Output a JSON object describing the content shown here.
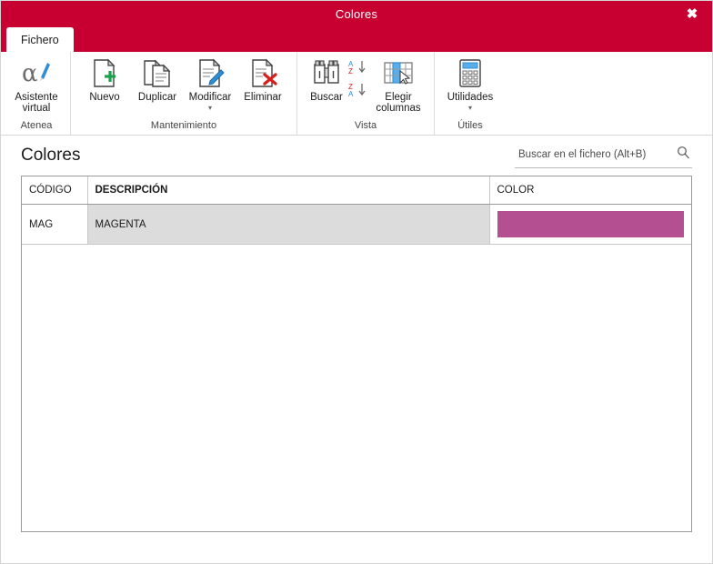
{
  "window": {
    "title": "Colores",
    "close_label": "✖",
    "accent_color": "#c80032"
  },
  "tabs": [
    {
      "label": "Fichero",
      "active": true
    }
  ],
  "ribbon": {
    "groups": [
      {
        "label": "Atenea",
        "items": [
          {
            "label": "Asistente\nvirtual",
            "icon": "alpha-pen-icon",
            "caret": false
          }
        ]
      },
      {
        "label": "Mantenimiento",
        "items": [
          {
            "label": "Nuevo",
            "icon": "document-plus-icon",
            "caret": false
          },
          {
            "label": "Duplicar",
            "icon": "document-copy-icon",
            "caret": false
          },
          {
            "label": "Modificar",
            "icon": "document-pencil-icon",
            "caret": true
          },
          {
            "label": "Eliminar",
            "icon": "document-delete-icon",
            "caret": false
          }
        ]
      },
      {
        "label": "Vista",
        "items": [
          {
            "label": "Buscar",
            "icon": "binoculars-icon",
            "caret": false
          },
          {
            "label": "sort-asc",
            "icon": "sort-az-icon",
            "caret": false
          },
          {
            "label": "sort-desc",
            "icon": "sort-za-icon",
            "caret": false
          },
          {
            "label": "Elegir\ncolumnas",
            "icon": "choose-columns-icon",
            "caret": false
          }
        ]
      },
      {
        "label": "Útiles",
        "items": [
          {
            "label": "Utilidades",
            "icon": "calculator-icon",
            "caret": true
          }
        ]
      }
    ],
    "labels": {
      "asistente_line1": "Asistente",
      "asistente_line2": "virtual",
      "nuevo": "Nuevo",
      "duplicar": "Duplicar",
      "modificar": "Modificar",
      "eliminar": "Eliminar",
      "buscar": "Buscar",
      "elegir_line1": "Elegir",
      "elegir_line2": "columnas",
      "utilidades": "Utilidades",
      "group_atenea": "Atenea",
      "group_mantenimiento": "Mantenimiento",
      "group_vista": "Vista",
      "group_utiles": "Útiles",
      "caret": "▾"
    }
  },
  "page": {
    "title": "Colores"
  },
  "search": {
    "placeholder": "Buscar en el fichero (Alt+B)",
    "value": "",
    "icon": "search-icon"
  },
  "table": {
    "columns": [
      {
        "key": "codigo",
        "label": "CÓDIGO",
        "bold": false
      },
      {
        "key": "descripcion",
        "label": "DESCRIPCIÓN",
        "bold": true
      },
      {
        "key": "color",
        "label": "COLOR",
        "bold": false
      }
    ],
    "rows": [
      {
        "codigo": "MAG",
        "descripcion": "MAGENTA",
        "color_hex": "#b45091",
        "selected": true
      }
    ]
  }
}
